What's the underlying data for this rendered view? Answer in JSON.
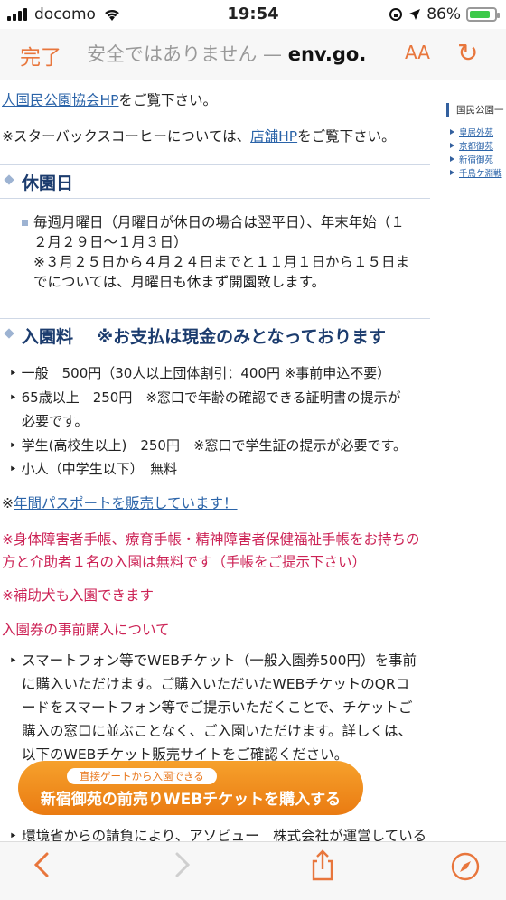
{
  "status": {
    "carrier": "docomo",
    "time": "19:54",
    "battery": "86%",
    "battery_level": 0.86
  },
  "browser": {
    "done": "完了",
    "url_prefix": "安全ではありません — ",
    "url_domain": "env.go.",
    "text_size": "AA"
  },
  "content": {
    "line1_link": "人国民公園協会HP",
    "line1_rest": "をご覧下さい。",
    "starbucks_pre": "※スターバックスコーヒーについては、",
    "starbucks_link": "店舗HP",
    "starbucks_post": "をご覧下さい。",
    "closed_title": "休園日",
    "closed_l1": "毎週月曜日（月曜日が休日の場合は翌平日）、年末年始（１",
    "closed_l2": "２月２９日〜１月３日）",
    "closed_l3": "※３月２５日から４月２４日までと１１月１日から１５日ま",
    "closed_l4": "でについては、月曜日も休まず開園致します。",
    "fee_title": "入園料　 ※お支払は現金のみとなっております",
    "fee_adult": "一般　500円（30人以上団体割引：400円 ※事前申込不要）",
    "fee_senior_1": "65歳以上　250円　※窓口で年齢の確認できる証明書の提示が",
    "fee_senior_2": "必要です。",
    "fee_student": "学生(高校生以上)　250円　※窓口で学生証の提示が必要です。",
    "fee_child": "小人（中学生以下）　無料",
    "passport_prefix": "※",
    "passport_link": "年間パスポートを販売しています！",
    "disability_1": "※身体障害者手帳、療育手帳・精神障害者保健福祉手帳をお持ちの",
    "disability_2": "方と介助者１名の入園は無料です（手帳をご提示下さい）",
    "guide_dog": "※補助犬も入園できます",
    "advance_title": "入園券の事前購入について",
    "advance_l1": "スマートフォン等でWEBチケット（一般入園券500円）を事前",
    "advance_l2": "に購入いただけます。ご購入いただいたWEBチケットのQRコ",
    "advance_l3": "ードをスマートフォン等でご提示いただくことで、チケットご",
    "advance_l4": "購入の窓口に並ぶことなく、ご入園いただけます。詳しくは、",
    "advance_l5": "以下のWEBチケット販売サイトをご確認ください。",
    "buy_sub": "直接ゲートから入園できる",
    "buy_main": "新宿御苑の前売りWEBチケットを購入する",
    "cutoff": "環境省からの請負により、アソビュー　株式会社が運営している"
  },
  "sidebar": {
    "title": "国民公園一",
    "items": [
      "皇居外苑",
      "京都御苑",
      "新宿御苑",
      "千鳥ケ淵戦"
    ]
  },
  "icons": [
    "wifi-icon",
    "location-icon",
    "reload-icon",
    "back-icon",
    "forward-icon",
    "share-icon",
    "compass-icon"
  ],
  "accent_color": "#e8763c"
}
